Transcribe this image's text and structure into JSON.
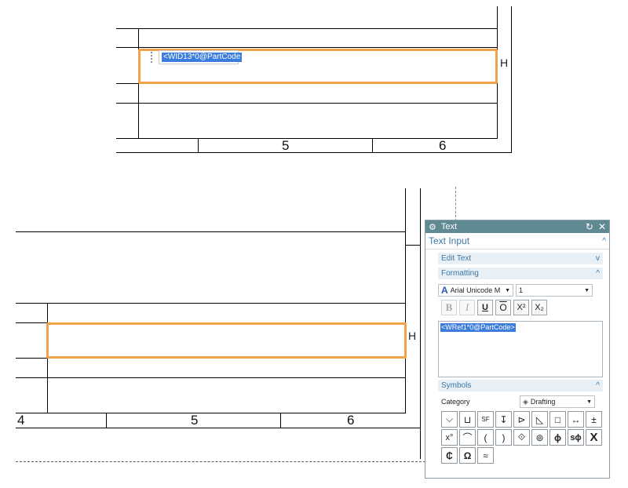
{
  "top_drawing": {
    "note_text": "<WID13*0@PartCode",
    "h_label": "H",
    "cells": [
      "5",
      "6"
    ]
  },
  "bottom_drawing": {
    "h_label": "H",
    "cells": [
      "4",
      "5",
      "6"
    ]
  },
  "panel": {
    "title": "Text",
    "refresh_icon": "refresh-icon",
    "close_icon": "close-icon",
    "section_text_input": "Text Input",
    "edit_text_label": "Edit Text",
    "formatting_label": "Formatting",
    "font_name": "Arial Unicode M",
    "font_size": "1",
    "format_buttons": [
      "B",
      "I",
      "U",
      "O",
      "X²",
      "X₂"
    ],
    "text_value": "<WRef1*0@PartCode>",
    "symbols_label": "Symbols",
    "category_label": "Category",
    "category_value": "Drafting",
    "symbols": [
      "⌵",
      "⊔",
      "SF",
      "↧",
      "⊳",
      "◺",
      "□",
      "↔",
      "±",
      "x°",
      "⌒",
      "(",
      ")",
      "⟐",
      "⊚",
      "ϕ",
      "sϕ",
      "X",
      "₵",
      "Ω",
      "≈"
    ]
  }
}
